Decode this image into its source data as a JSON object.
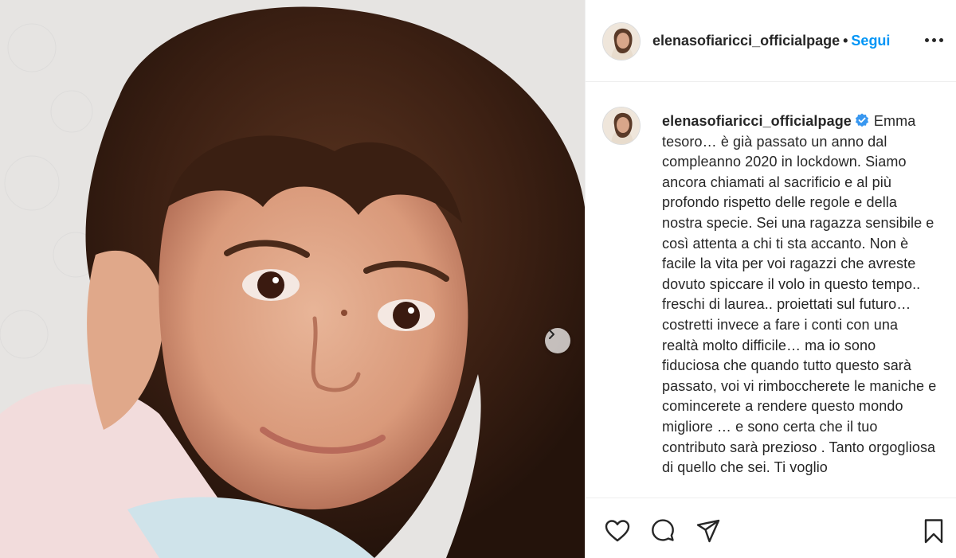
{
  "post": {
    "photo": {
      "alt_icon": "child-portrait-photo",
      "next_icon": "chevron-right-icon"
    },
    "header": {
      "username": "elenasofiaricci_officialpage",
      "separator": "•",
      "follow_label": "Segui",
      "more_icon": "more-options-icon"
    },
    "caption": {
      "username": "elenasofiaricci_officialpage",
      "verified_icon": "verified-badge-icon",
      "text": "Emma tesoro… è già passato un anno dal compleanno 2020 in lockdown. Siamo ancora chiamati al sacrificio e al più profondo rispetto delle regole e della nostra specie. Sei una ragazza sensibile e così attenta a chi ti sta accanto. Non è facile la vita per voi ragazzi che avreste dovuto spiccare il volo in questo tempo.. freschi di laurea.. proiettati sul futuro… costretti invece a fare i conti con una realtà molto difficile… ma io sono fiduciosa che quando tutto questo sarà passato, voi vi rimboccherete le maniche e comincerete a rendere questo mondo migliore … e sono certa che il tuo contributo sarà prezioso . Tanto orgogliosa di quello che sei. Ti voglio"
    },
    "actions": {
      "like_icon": "heart-icon",
      "comment_icon": "comment-icon",
      "share_icon": "send-icon",
      "save_icon": "bookmark-icon"
    },
    "colors": {
      "accent": "#0095f6",
      "text": "#262626",
      "border": "#efefef"
    }
  }
}
